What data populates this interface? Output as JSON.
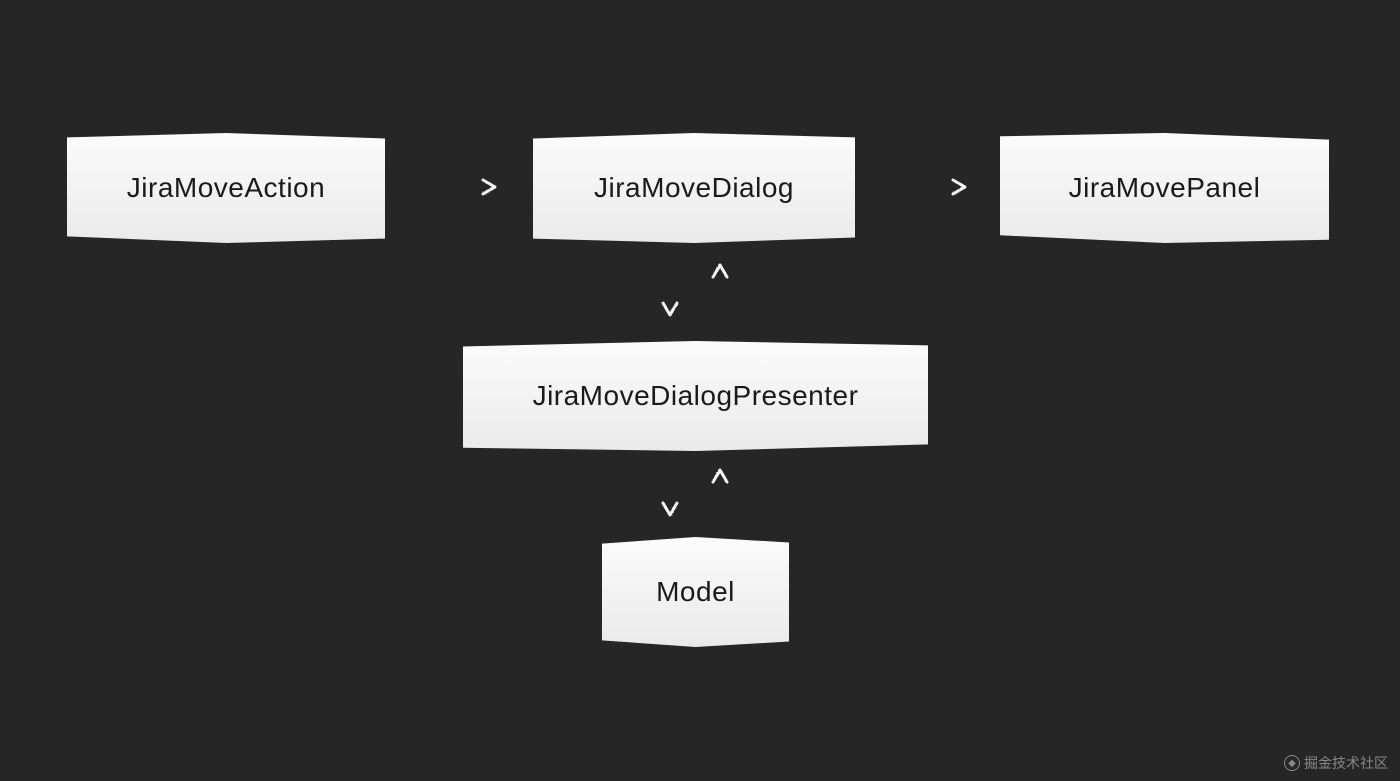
{
  "diagram": {
    "nodes": {
      "action": "JiraMoveAction",
      "dialog": "JiraMoveDialog",
      "panel": "JiraMovePanel",
      "presenter": "JiraMoveDialogPresenter",
      "model": "Model"
    },
    "edges": [
      {
        "from": "action",
        "to": "dialog",
        "direction": "right"
      },
      {
        "from": "dialog",
        "to": "panel",
        "direction": "right"
      },
      {
        "from": "dialog",
        "to": "presenter",
        "direction": "bidirectional-vertical"
      },
      {
        "from": "presenter",
        "to": "model",
        "direction": "bidirectional-vertical"
      }
    ]
  },
  "watermark": {
    "text": "掘金技术社区"
  }
}
